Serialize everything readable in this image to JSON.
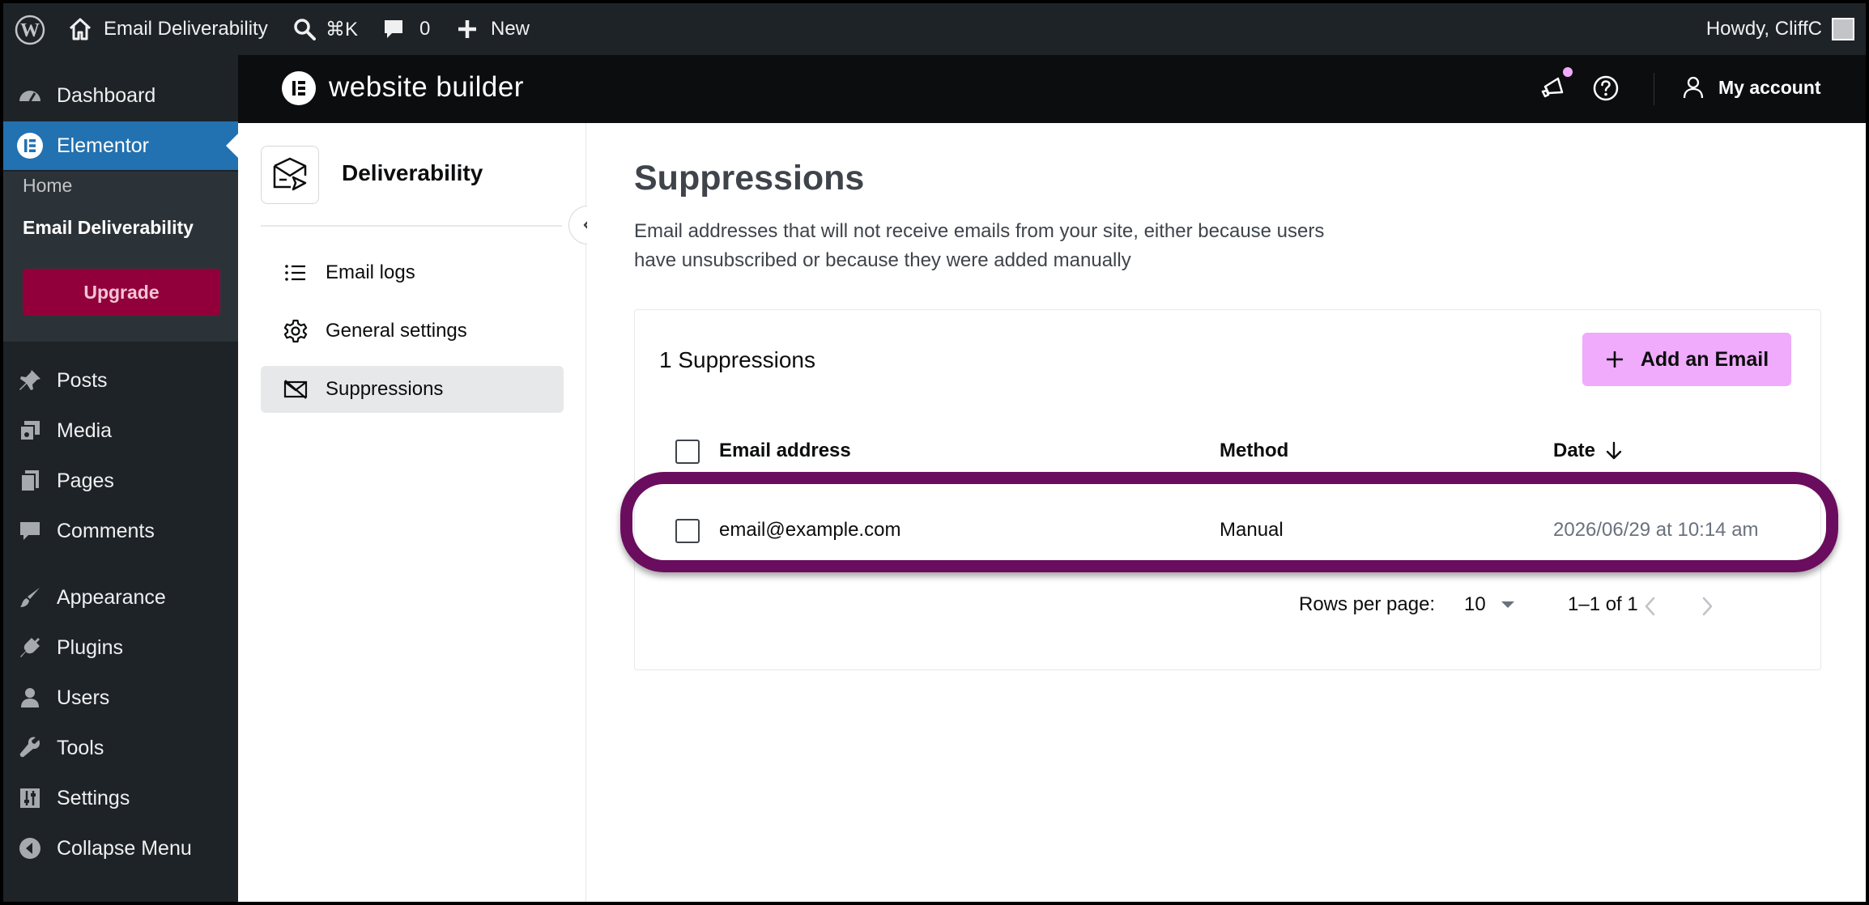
{
  "adminbar": {
    "site_name": "Email Deliverability",
    "search_shortcut": "⌘K",
    "comments_count": "0",
    "new_label": "New",
    "howdy": "Howdy, CliffC"
  },
  "wpmenu": {
    "items": [
      {
        "label": "Dashboard",
        "icon": "dashboard-icon"
      },
      {
        "label": "Elementor",
        "icon": "elementor-icon"
      },
      {
        "label": "Posts",
        "icon": "pin-icon"
      },
      {
        "label": "Media",
        "icon": "media-icon"
      },
      {
        "label": "Pages",
        "icon": "pages-icon"
      },
      {
        "label": "Comments",
        "icon": "comment-icon"
      },
      {
        "label": "Appearance",
        "icon": "brush-icon"
      },
      {
        "label": "Plugins",
        "icon": "plug-icon"
      },
      {
        "label": "Users",
        "icon": "user-icon"
      },
      {
        "label": "Tools",
        "icon": "wrench-icon"
      },
      {
        "label": "Settings",
        "icon": "sliders-icon"
      },
      {
        "label": "Collapse Menu",
        "icon": "collapse-icon"
      }
    ],
    "submenu": {
      "home": "Home",
      "email_deliverability": "Email Deliverability",
      "upgrade": "Upgrade"
    },
    "active_color": "#2271b1",
    "upgrade_color": "#92003b"
  },
  "ebar": {
    "title": "website builder",
    "account": "My account",
    "notification_dot_color": "#f0abfc"
  },
  "plugin_sidebar": {
    "title": "Deliverability",
    "nav": [
      {
        "label": "Email logs",
        "icon": "list-icon"
      },
      {
        "label": "General settings",
        "icon": "gear-icon"
      },
      {
        "label": "Suppressions",
        "icon": "mail-off-icon"
      }
    ]
  },
  "main": {
    "title": "Suppressions",
    "description_line1": "Email addresses that will not receive emails from your site, either because users",
    "description_line2": "have unsubscribed or because they were added manually",
    "count_label": "1 Suppressions",
    "add_button": "Add an Email",
    "columns": {
      "email": "Email address",
      "method": "Method",
      "date": "Date"
    },
    "rows": [
      {
        "email": "email@example.com",
        "method": "Manual",
        "date": "2026/06/29 at 10:14 am"
      }
    ],
    "pagination": {
      "rows_per_page_label": "Rows per page:",
      "rows_per_page": "10",
      "range": "1–1 of 1"
    },
    "highlight_color": "#6a0d5e",
    "accent_color": "#f0abfc"
  }
}
